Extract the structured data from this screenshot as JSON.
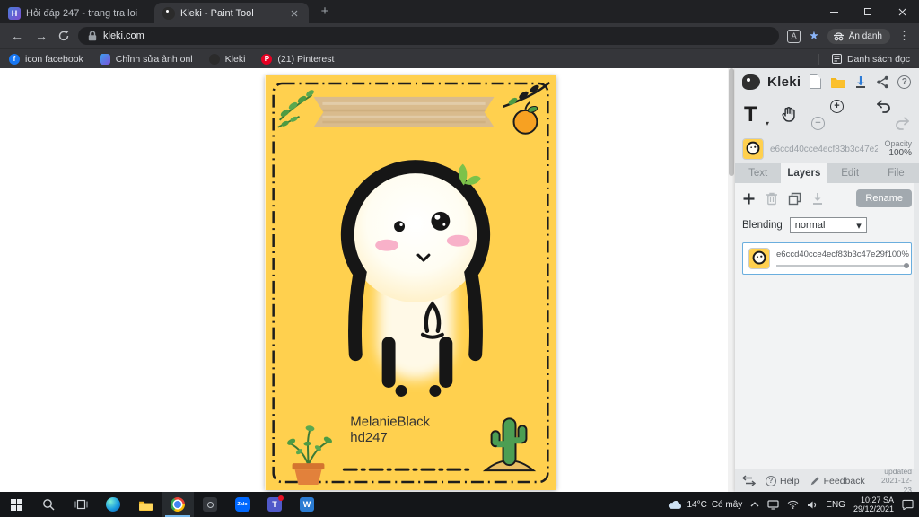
{
  "colors": {
    "chrome_dark": "#202124",
    "chrome_toolbar": "#35363a",
    "panel_grey": "#e5e7e9",
    "canvas_yellow": "#ffd04e",
    "banner_tan": "#d9bb8d",
    "layer_selected_border": "#6aaede",
    "taskbar_dark": "#141619",
    "accent_blue": "#8ab4f8"
  },
  "icons": {
    "back_arrow": "←",
    "forward_arrow": "→",
    "menu_dots": "⋮",
    "star": "★",
    "translate_letter": "A",
    "new_tab_plus": "+",
    "caret_down": "▾",
    "plus": "+",
    "minus": "−",
    "question_mark": "?"
  },
  "browser": {
    "tabs": [
      {
        "title": "Hỏi đáp 247 - trang tra loi",
        "favicon_letter": "H"
      },
      {
        "title": "Kleki - Paint Tool"
      }
    ],
    "address": "kleki.com",
    "profile_label": "Ẩn danh",
    "bookmarks": [
      {
        "label": "icon facebook",
        "letter": "f"
      },
      {
        "label": "Chỉnh sửa ảnh onl"
      },
      {
        "label": "Kleki"
      },
      {
        "label": "(21) Pinterest",
        "letter": "P"
      }
    ],
    "reading_list": "Danh sách đọc"
  },
  "kleki": {
    "brand": "Kleki",
    "text_tool_letter": "T",
    "brush_hash": "e6ccd40cce4ecf83b3c47e2",
    "opacity_label": "Opacity",
    "opacity_value": "100%",
    "tabs": [
      {
        "label": "Text"
      },
      {
        "label": "Layers"
      },
      {
        "label": "Edit"
      },
      {
        "label": "File"
      }
    ],
    "rename_button": "Rename",
    "blending_label": "Blending",
    "blending_value": "normal",
    "layer": {
      "name": "e6ccd40cce4ecf83b3c47e29f",
      "opacity": "100%"
    },
    "help_label": "Help",
    "feedback_label": "Feedback",
    "updated_label": "updated",
    "updated_date": "2021-12-23"
  },
  "canvas": {
    "name_line1": "MelanieBlack",
    "name_line2": "hd247"
  },
  "taskbar": {
    "weather_temp": "14°C",
    "weather_desc": "Có mây",
    "language": "ENG",
    "time": "10:27 SA",
    "date": "29/12/2021",
    "app_labels": {
      "zalo": "Zalo",
      "teams": "T",
      "word": "W"
    }
  }
}
